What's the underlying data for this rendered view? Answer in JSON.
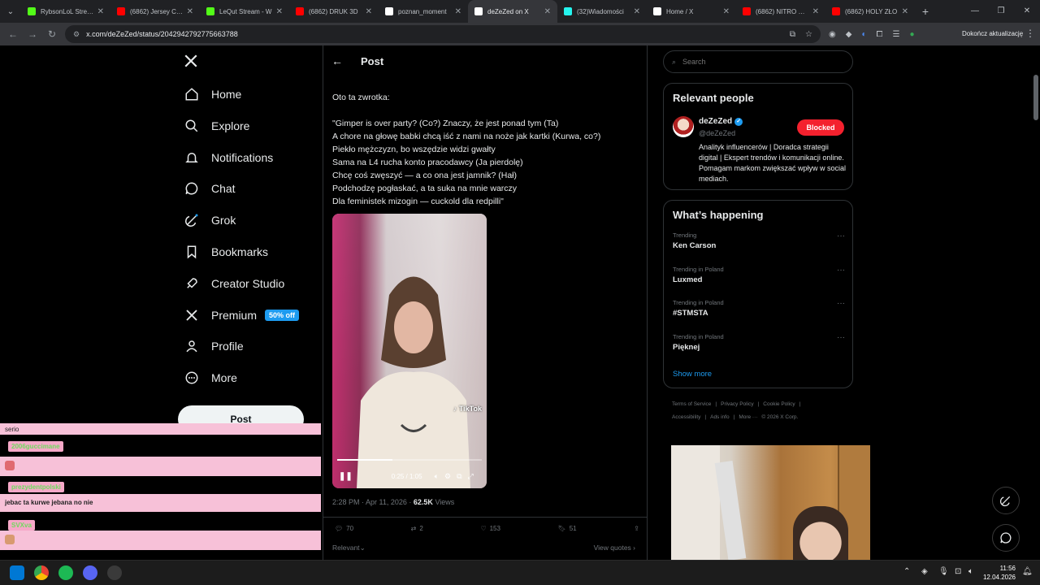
{
  "browser": {
    "tabs": [
      {
        "title": "RybsonLoL Stream",
        "color": "#53fc18"
      },
      {
        "title": "(6862) Jersey Club",
        "color": "#ff0000"
      },
      {
        "title": "LeQut Stream - W",
        "color": "#53fc18"
      },
      {
        "title": "(6862) DRUK 3D",
        "color": "#ff0000"
      },
      {
        "title": "poznan_moment",
        "color": "#ffffff"
      },
      {
        "title": "deZeZed on X",
        "color": "#ffffff",
        "active": true
      },
      {
        "title": "(32)Wiadomości",
        "color": "#25f4ee"
      },
      {
        "title": "Home / X",
        "color": "#ffffff"
      },
      {
        "title": "(6862) NITRO O C",
        "color": "#ff0000"
      },
      {
        "title": "(6862) HOLY ZŁO",
        "color": "#ff0000"
      }
    ],
    "url": "x.com/deZeZed/status/2042942792775663788",
    "update_button": "Dokończ aktualizację"
  },
  "nav": {
    "items": [
      {
        "label": "Home",
        "icon": "home-icon"
      },
      {
        "label": "Explore",
        "icon": "search-icon"
      },
      {
        "label": "Notifications",
        "icon": "bell-icon"
      },
      {
        "label": "Chat",
        "icon": "chat-icon"
      },
      {
        "label": "Grok",
        "icon": "grok-icon"
      },
      {
        "label": "Bookmarks",
        "icon": "bookmark-icon"
      },
      {
        "label": "Creator Studio",
        "icon": "rocket-icon"
      },
      {
        "label": "Premium",
        "icon": "x-icon"
      },
      {
        "label": "Profile",
        "icon": "person-icon"
      },
      {
        "label": "More",
        "icon": "more-circle-icon"
      }
    ],
    "premium_badge": "50% off",
    "post_button": "Post"
  },
  "chat_overlay": {
    "messages": [
      {
        "text": "serio"
      },
      {
        "user": "2006guccimane",
        "text": ""
      },
      {
        "user": "prezydentpolski",
        "text": "jebac ta kurwe jebana no nie"
      },
      {
        "user": "SVXva",
        "text": ""
      }
    ]
  },
  "post": {
    "header_title": "Post",
    "lines": [
      "Oto ta zwrotka:",
      "",
      "\"Gimper is over party? (Co?) Znaczy, że jest ponad tym (Ta)",
      "A chore na głowę babki chcą iść z nami na noże jak kartki (Kurwa, co?)",
      "Piekło mężczyzn, bo wszędzie widzi gwałty",
      "Sama na L4 rucha konto pracodawcy (Ja pierdolę)",
      "Chcę coś zwęszyć — a co ona jest jamnik? (Hał)",
      "Podchodzę pogłaskać, a ta suka na mnie warczy",
      "Dla feministek mizogin — cuckold dla redpilli\""
    ],
    "video": {
      "watermark": "TikTok",
      "time": "0:25 / 1:05",
      "progress": 0.38
    },
    "timestamp": "2:28 PM · Apr 11, 2026",
    "views_count": "62.5K",
    "views_label": "Views",
    "replies": "70",
    "reposts": "2",
    "likes": "153",
    "bookmarks": "51",
    "sort_label": "Relevant",
    "view_quotes": "View quotes"
  },
  "right": {
    "search_placeholder": "Search",
    "relevant_title": "Relevant people",
    "person": {
      "name": "deZeZed",
      "handle": "@deZeZed",
      "button": "Blocked",
      "bio": "Analityk influencerów | Doradca strategii digital | Ekspert trendów i komunikacji online. Pomagam markom zwiększać wpływ w social mediach."
    },
    "happening_title": "What’s happening",
    "trends": [
      {
        "context": "Trending",
        "topic": "Ken Carson"
      },
      {
        "context": "Trending in Poland",
        "topic": "Luxmed"
      },
      {
        "context": "Trending in Poland",
        "topic": "#STMSTA"
      },
      {
        "context": "Trending in Poland",
        "topic": "Pięknej"
      }
    ],
    "show_more": "Show more",
    "footer": [
      "Terms of Service",
      "Privacy Policy",
      "Cookie Policy",
      "Accessibility",
      "Ads info",
      "More ···",
      "© 2026 X Corp."
    ]
  },
  "taskbar": {
    "time": "11:56",
    "date": "12.04.2026"
  }
}
